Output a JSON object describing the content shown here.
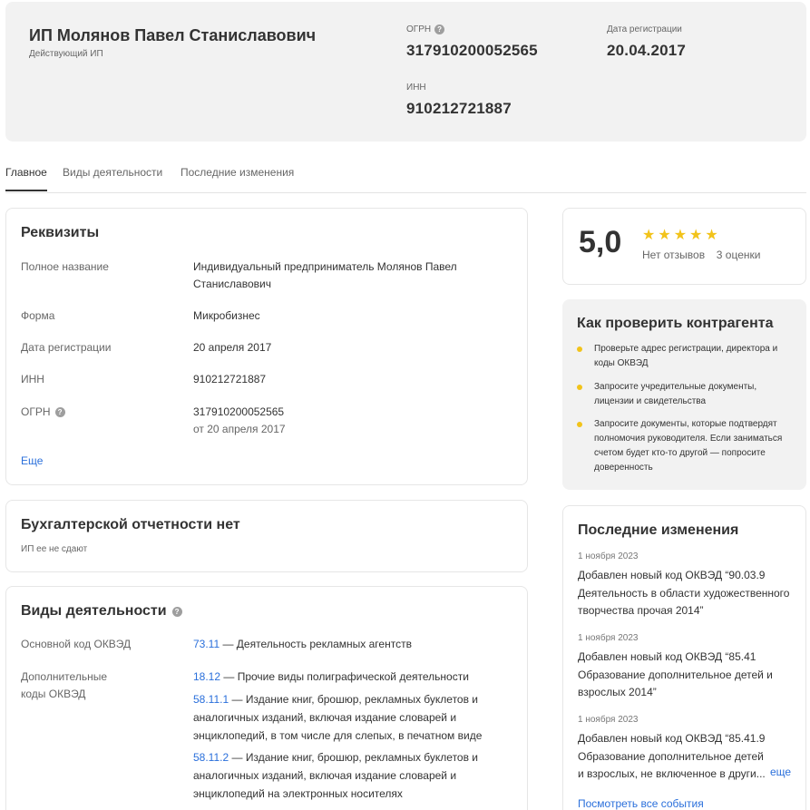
{
  "header": {
    "name": "ИП Молянов Павел Станиславович",
    "status": "Действующий ИП",
    "ogrn_label": "ОГРН",
    "ogrn_value": "317910200052565",
    "reg_label": "Дата регистрации",
    "reg_value": "20.04.2017",
    "inn_label": "ИНН",
    "inn_value": "910212721887"
  },
  "tabs": [
    "Главное",
    "Виды деятельности",
    "Последние изменения"
  ],
  "requisites": {
    "title": "Реквизиты",
    "full_name_label": "Полное название",
    "full_name_value": "Индивидуальный предприниматель Молянов Павел Станиславович",
    "form_label": "Форма",
    "form_value": "Микробизнес",
    "reg_label": "Дата регистрации",
    "reg_value": "20 апреля 2017",
    "inn_label": "ИНН",
    "inn_value": "910212721887",
    "ogrn_label": "ОГРН",
    "ogrn_value": "317910200052565",
    "ogrn_sub": "от 20 апреля 2017",
    "more": "Еще"
  },
  "accounting": {
    "title": "Бухгалтерской отчетности нет",
    "subtitle": "ИП ее не сдают"
  },
  "activities": {
    "title": "Виды деятельности",
    "main_label": "Основной код ОКВЭД",
    "main_code": "73.11",
    "main_text": " — Деятельность рекламных агентств",
    "additional_label": "Дополнительные коды ОКВЭД",
    "additional": [
      {
        "code": "18.12",
        "text": " — Прочие виды полиграфической деятельности"
      },
      {
        "code": "58.11.1",
        "text": " — Издание книг, брошюр, рекламных буклетов и аналогичных изданий, включая издание словарей и энциклопедий, в том числе для слепых, в печатном виде"
      },
      {
        "code": "58.11.2",
        "text": " — Издание книг, брошюр, рекламных буклетов и аналогичных изданий, включая издание словарей и энциклопедий на электронных носителях"
      }
    ]
  },
  "rating": {
    "value": "5,0",
    "reviews": "Нет отзывов",
    "ratings_count": "3 оценки",
    "stars": 5,
    "star_color": "#f2c31a"
  },
  "check": {
    "title": "Как проверить контрагента",
    "items": [
      "Проверьте адрес регистрации, директора и коды ОКВЭД",
      "Запросите учредительные документы, лицензии и свидетельства",
      "Запросите документы, которые подтвердят полномочия руководителя. Если заниматься счетом будет кто-то другой — попросите доверенность"
    ]
  },
  "changes": {
    "title": "Последние изменения",
    "items": [
      {
        "date": "1 ноября 2023",
        "text": "Добавлен новый код ОКВЭД “90.03.9 Деятельность в области художественного творчества прочая 2014”"
      },
      {
        "date": "1 ноября 2023",
        "text": "Добавлен новый код ОКВЭД “85.41 Образование дополнительное детей и взрослых 2014”"
      },
      {
        "date": "1 ноября 2023",
        "text": "Добавлен новый код ОКВЭД “85.41.9 Образование дополнительное детей и взрослых, не включенное в други..."
      }
    ],
    "more": "еще",
    "see_all": "Посмотреть все события"
  },
  "colors": {
    "accent_link": "#2a6fdb",
    "header_bg": "#f2f2f2",
    "bullet": "#f2c31a"
  }
}
